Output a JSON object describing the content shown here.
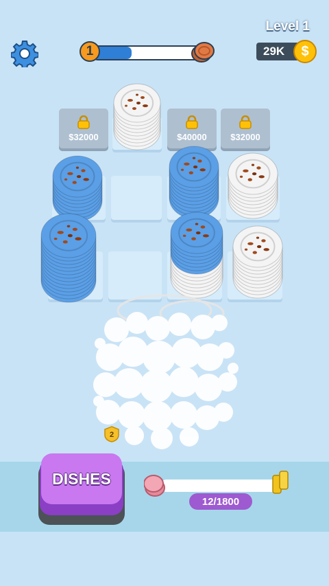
{
  "hud": {
    "level_label": "Level 1",
    "level_number": "1",
    "level_progress_percent": 35,
    "coins": "29K",
    "coin_symbol": "$"
  },
  "board": {
    "locked_slots": [
      {
        "price": "$32000"
      },
      {
        "price": "$40000"
      },
      {
        "price": "$32000"
      }
    ],
    "wash_badge": "2"
  },
  "bottom": {
    "dishes_button_label": "DISHES",
    "dish_count": "12/1800"
  },
  "colors": {
    "background": "#c9e3f6",
    "blue_plate": "#5b9fe6",
    "white_plate": "#f4f4f4",
    "stain": "#a04a1c",
    "button_purple": "#c978f0",
    "coin_gold": "#ffc107"
  }
}
